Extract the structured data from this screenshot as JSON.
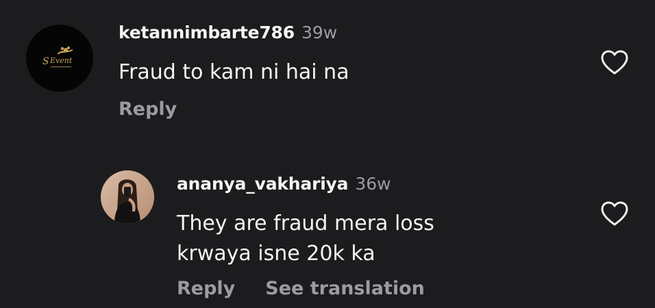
{
  "comments": [
    {
      "username": "ketannimbarte786",
      "time": "39w",
      "text": "Fraud to kam ni hai na",
      "reply_label": "Reply",
      "avatar_logo_text": "S Event"
    },
    {
      "username": "ananya_vakhariya",
      "time": "36w",
      "text_line1": "They are fraud mera loss",
      "text_line2": "krwaya isne 20k ka",
      "reply_label": "Reply",
      "translate_label": "See translation"
    }
  ]
}
